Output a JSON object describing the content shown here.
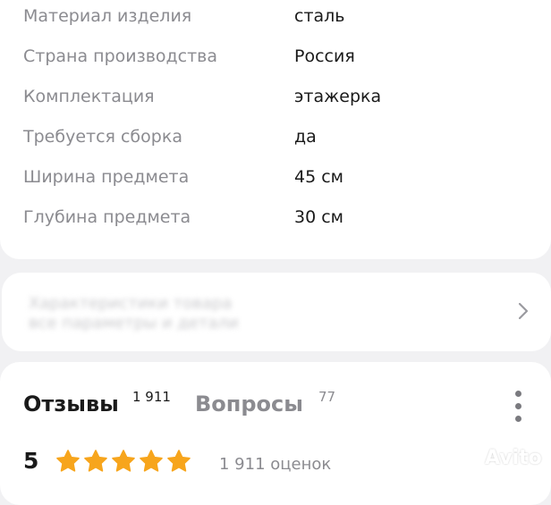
{
  "specs": [
    {
      "label": "Материал изделия",
      "value": "сталь"
    },
    {
      "label": "Страна производства",
      "value": "Россия"
    },
    {
      "label": "Комплектация",
      "value": "этажерка"
    },
    {
      "label": "Требуется сборка",
      "value": "да"
    },
    {
      "label": "Ширина предмета",
      "value": "45 см"
    },
    {
      "label": "Глубина предмета",
      "value": "30 см"
    }
  ],
  "blurred_section": {
    "line1": "Характеристики товара",
    "line2": "все параметры и детали",
    "chevron_icon": "chevron-right-icon"
  },
  "reviews": {
    "tab_reviews_label": "Отзывы",
    "tab_reviews_count": "1 911",
    "tab_questions_label": "Вопросы",
    "tab_questions_count": "77",
    "more_icon": "more-vertical-icon",
    "rating_value": "5",
    "rating_stars": 5,
    "rating_count_label": "1 911 оценок"
  },
  "watermark": {
    "text": "Avito"
  },
  "colors": {
    "star": "#f7a51c",
    "label_gray": "#8b8b90",
    "text_dark": "#1a1a1a",
    "background": "#f1f1f3"
  }
}
